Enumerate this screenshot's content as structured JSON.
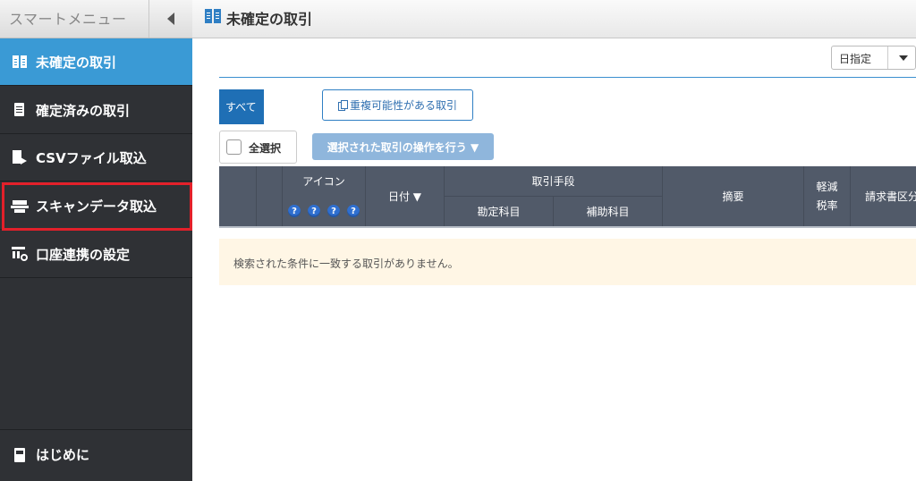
{
  "sidebar": {
    "title": "スマートメニュー",
    "items": [
      {
        "label": "未確定の取引",
        "icon": "ledger-book-icon"
      },
      {
        "label": "確定済みの取引",
        "icon": "document-icon"
      },
      {
        "label": "CSVファイル取込",
        "icon": "csv-import-icon"
      },
      {
        "label": "スキャンデータ取込",
        "icon": "scanner-icon"
      },
      {
        "label": "口座連携の設定",
        "icon": "bank-settings-icon"
      }
    ],
    "bottom_item": {
      "label": "はじめに",
      "icon": "guide-book-icon"
    },
    "highlight_color": "#e3202a",
    "active_color": "#3a9ad5"
  },
  "header": {
    "title": "未確定の取引"
  },
  "toolbar": {
    "date_filter": "日指定",
    "tab_all": "すべて",
    "duplicate_button": "重複可能性がある取引",
    "select_all": "全選択",
    "bulk_action": "選択された取引の操作を行う ▼"
  },
  "table": {
    "columns": {
      "icon": "アイコン",
      "date": "日付 ▼",
      "means": "取引手段",
      "account": "勘定科目",
      "sub_account": "補助科目",
      "summary": "摘要",
      "reduced_tax_1": "軽減",
      "reduced_tax_2": "税率",
      "invoice": "請求書区分"
    },
    "help_icons": [
      "?",
      "?",
      "?",
      "?"
    ],
    "empty_message": "検索された条件に一致する取引がありません。"
  }
}
